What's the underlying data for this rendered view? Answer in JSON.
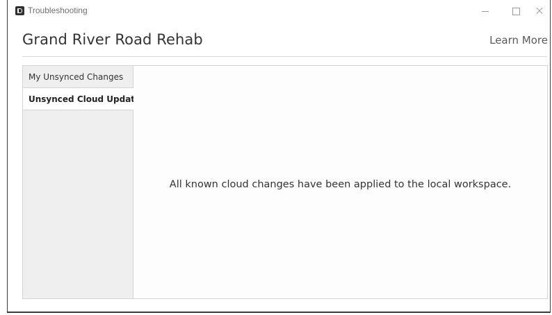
{
  "window": {
    "title": "Troubleshooting",
    "icon": "app-icon"
  },
  "header": {
    "project_name": "Grand River Road Rehab",
    "learn_more": "Learn More"
  },
  "sidebar": {
    "tabs": [
      {
        "label": "My Unsynced Changes",
        "selected": false
      },
      {
        "label": "Unsynced Cloud Updates",
        "selected": true
      }
    ]
  },
  "content": {
    "message": "All known cloud changes have been applied to the local workspace."
  }
}
